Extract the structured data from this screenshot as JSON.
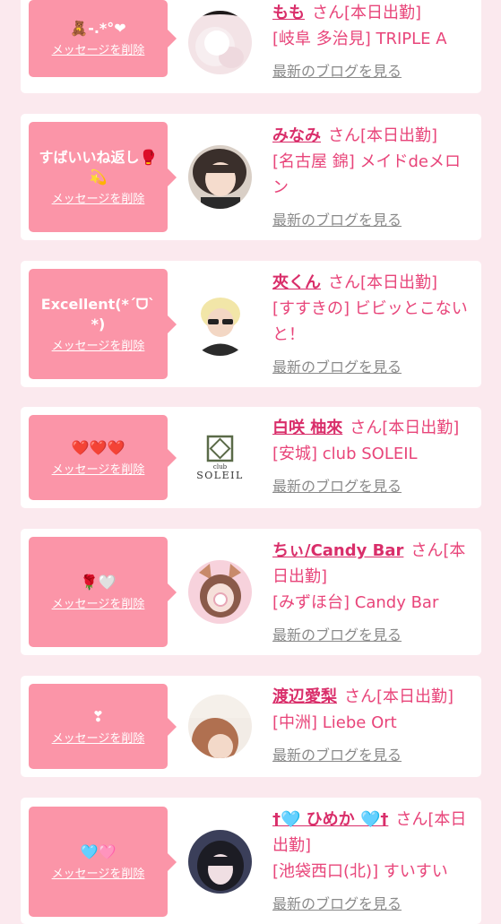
{
  "cards": [
    {
      "message": "🧸-.*°❤",
      "delete_label": "メッセージを削除",
      "name": "もも",
      "suffix": "さん[本日出勤]",
      "shop": "[岐阜 多治見] TRIPLE A",
      "blog_label": "最新のブログを見る",
      "avatar": "photo-white-dress"
    },
    {
      "message": "すばいいね返し🥊💫",
      "delete_label": "メッセージを削除",
      "name": "みなみ",
      "suffix": "さん[本日出勤]",
      "shop": "[名古屋 錦] メイドdeメロン",
      "blog_label": "最新のブログを見る",
      "avatar": "photo-short-hair"
    },
    {
      "message": "Excellent(*ˊᗜˋ*)",
      "delete_label": "メッセージを削除",
      "name": "夾くん",
      "suffix": "さん[本日出勤]",
      "shop": "[すすきの] ビビッとこないと！",
      "blog_label": "最新のブログを見る",
      "avatar": "photo-blond-glasses"
    },
    {
      "message": "❤️❤️❤️",
      "delete_label": "メッセージを削除",
      "name": "白咲 柚來",
      "suffix": "さん[本日出勤]",
      "shop": "[安城] club SOLEIL",
      "blog_label": "最新のブログを見る",
      "avatar": "logo-club-soleil",
      "logo_text_small": "club",
      "logo_text_big": "SOLEIL"
    },
    {
      "message": "🌹🤍",
      "delete_label": "メッセージを削除",
      "name": "ちぃ/Candy Bar",
      "suffix": "さん[本日出勤]",
      "shop": "[みずほ台] Candy Bar",
      "blog_label": "最新のブログを見る",
      "avatar": "photo-cat-ears"
    },
    {
      "message": "❣",
      "delete_label": "メッセージを削除",
      "name": "渡辺愛梨",
      "suffix": "さん[本日出勤]",
      "shop": "[中洲] Liebe Ort",
      "blog_label": "最新のブログを見る",
      "avatar": "photo-brown-hair"
    },
    {
      "message": "🩵🩷",
      "delete_label": "メッセージを削除",
      "name": "†🩵 ひめか 🩵†",
      "suffix": "さん[本日出勤]",
      "shop": "[池袋西口(北)] すいすい",
      "blog_label": "最新のブログを見る",
      "avatar": "photo-dark-hair"
    }
  ]
}
